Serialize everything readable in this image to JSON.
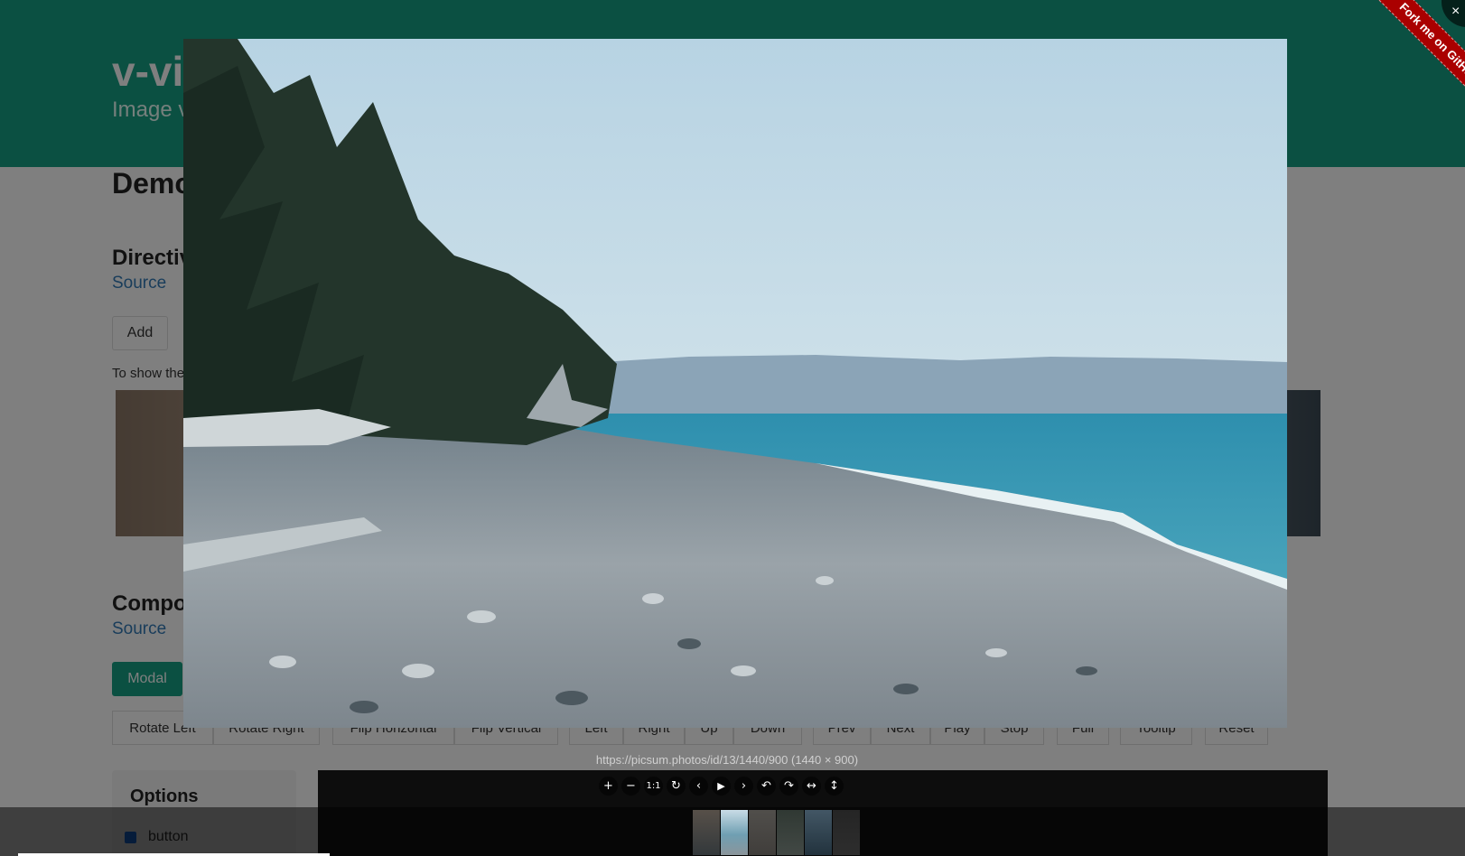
{
  "hero": {
    "title": "v-viewer",
    "subtitle": "Image viewer"
  },
  "demo": {
    "title": "Demo",
    "directive": {
      "heading": "Directive",
      "source_link": "Source",
      "add_button": "Add",
      "hint": "To show the viewer, click any image below."
    },
    "component": {
      "heading": "Component",
      "source_link": "Source",
      "modal_button": "Modal",
      "controls": [
        "Rotate Left",
        "Rotate Right",
        "Flip Horizontal",
        "Flip Vertical",
        "Left",
        "Right",
        "Up",
        "Down",
        "Prev",
        "Next",
        "Play",
        "Stop",
        "Full",
        "Tooltip",
        "Reset"
      ]
    },
    "options": {
      "title": "Options",
      "items": [
        {
          "label": "button",
          "checked": true
        }
      ]
    }
  },
  "viewer": {
    "caption": "https://picsum.photos/id/13/1440/900 (1440 × 900)",
    "toolbar": [
      {
        "icon": "zoom-in-icon",
        "glyph": "+"
      },
      {
        "icon": "zoom-out-icon",
        "glyph": "−"
      },
      {
        "icon": "one-to-one-icon",
        "glyph": "1:1"
      },
      {
        "icon": "reset-icon",
        "glyph": "↻"
      },
      {
        "icon": "prev-icon",
        "glyph": "‹"
      },
      {
        "icon": "play-icon",
        "glyph": "▶"
      },
      {
        "icon": "next-icon",
        "glyph": "›"
      },
      {
        "icon": "rotate-left-icon",
        "glyph": "↶"
      },
      {
        "icon": "rotate-right-icon",
        "glyph": "↷"
      },
      {
        "icon": "flip-horizontal-icon",
        "glyph": "↔"
      },
      {
        "icon": "flip-vertical-icon",
        "glyph": "↕"
      }
    ],
    "thumbnail_count": 6,
    "active_thumbnail": 2,
    "close_icon": "close-icon",
    "close_glyph": "×"
  },
  "github_ribbon": "Fork me on GitHub",
  "colors": {
    "brand": "#16a085",
    "link": "#337ab7",
    "ribbon": "#aa0000"
  }
}
